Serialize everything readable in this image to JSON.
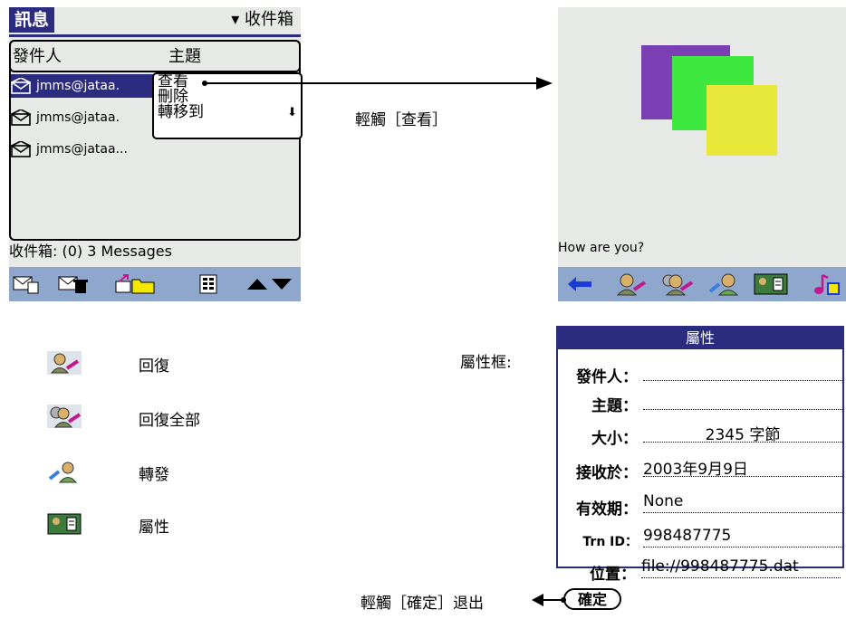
{
  "inbox": {
    "app_title": "訊息",
    "folder": "收件箱",
    "col_sender": "發件人",
    "col_subject": "主題",
    "messages": [
      {
        "sender": "jmms@jataa."
      },
      {
        "sender": "jmms@jataa."
      },
      {
        "sender": "jmms@jataa..."
      }
    ],
    "context_menu": [
      "查看",
      "刪除",
      "轉移到"
    ],
    "status": "收件箱: (0) 3 Messages"
  },
  "tap_view_label": "輕觸［查看］",
  "viewer": {
    "caption": "How are you?",
    "colors": {
      "purple": "#7a3fb3",
      "green": "#3ee83e",
      "yellow": "#e8e83a"
    }
  },
  "legend": [
    {
      "icon": "reply-icon",
      "label": "回復"
    },
    {
      "icon": "reply-all-icon",
      "label": "回復全部"
    },
    {
      "icon": "forward-icon",
      "label": "轉發"
    },
    {
      "icon": "properties-icon",
      "label": "屬性"
    }
  ],
  "props_label": "屬性框:",
  "properties": {
    "title": "屬性",
    "rows": [
      {
        "key": "發件人：",
        "value": ""
      },
      {
        "key": "主題：",
        "value": ""
      },
      {
        "key": "大小：",
        "value": "2345 字節"
      },
      {
        "key": "接收於：",
        "value": "2003年9月9日"
      },
      {
        "key": "有效期：",
        "value": "None"
      },
      {
        "key": "Trn ID：",
        "value": "998487775"
      },
      {
        "key": "位置：",
        "value": "file://998487775.dat"
      }
    ],
    "ok_label": "確定"
  },
  "tap_ok_label": "輕觸［確定］退出",
  "accent": "#2b2b80",
  "toolbar_color": "#8fa7cc"
}
